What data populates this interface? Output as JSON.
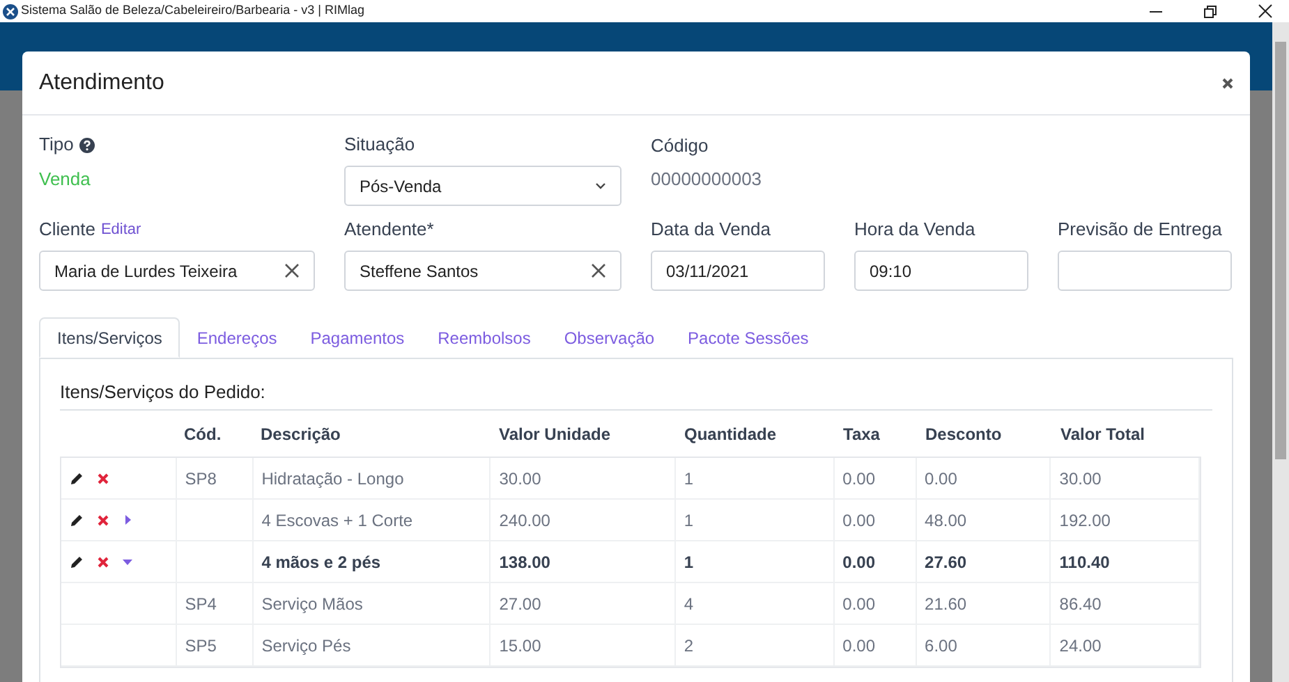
{
  "window": {
    "title": "Sistema Salão de Beleza/Cabeleireiro/Barbearia - v3 | RIMlag"
  },
  "modal": {
    "title": "Atendimento",
    "tipo": {
      "label": "Tipo",
      "value": "Venda"
    },
    "situacao": {
      "label": "Situação",
      "value": "Pós-Venda"
    },
    "codigo": {
      "label": "Código",
      "value": "00000000003"
    },
    "cliente": {
      "label": "Cliente",
      "link": "Editar",
      "value": "Maria de Lurdes Teixeira"
    },
    "atendente": {
      "label": "Atendente*",
      "value": "Steffene Santos"
    },
    "data_venda": {
      "label": "Data da Venda",
      "value": "03/11/2021"
    },
    "hora_venda": {
      "label": "Hora da Venda",
      "value": "09:10"
    },
    "previsao": {
      "label": "Previsão de Entrega"
    },
    "tabs": [
      {
        "label": "Itens/Serviços",
        "selected": true
      },
      {
        "label": "Endereços",
        "selected": false
      },
      {
        "label": "Pagamentos",
        "selected": false
      },
      {
        "label": "Reembolsos",
        "selected": false
      },
      {
        "label": "Observação",
        "selected": false
      },
      {
        "label": "Pacote Sessões",
        "selected": false
      }
    ],
    "section_title": "Itens/Serviços do Pedido:",
    "table": {
      "columns": [
        "Cód.",
        "Descrição",
        "Valor Unidade",
        "Quantidade",
        "Taxa",
        "Desconto",
        "Valor Total"
      ],
      "rows": [
        {
          "kind": "item",
          "cells": [
            "SP8",
            "Hidratação - Longo",
            "30.00",
            "1",
            "0.00",
            "0.00",
            "30.00"
          ]
        },
        {
          "kind": "package",
          "expanded": false,
          "cells": [
            "",
            "4 Escovas + 1 Corte",
            "240.00",
            "1",
            "0.00",
            "48.00",
            "192.00"
          ]
        },
        {
          "kind": "package",
          "expanded": true,
          "cells": [
            "",
            "4 mãos e 2 pés",
            "138.00",
            "1",
            "0.00",
            "27.60",
            "110.40"
          ]
        },
        {
          "kind": "child",
          "cells": [
            "SP4",
            "Serviço Mãos",
            "27.00",
            "4",
            "0.00",
            "21.60",
            "86.40"
          ]
        },
        {
          "kind": "child",
          "cells": [
            "SP5",
            "Serviço Pés",
            "15.00",
            "2",
            "0.00",
            "6.00",
            "24.00"
          ]
        }
      ]
    }
  }
}
